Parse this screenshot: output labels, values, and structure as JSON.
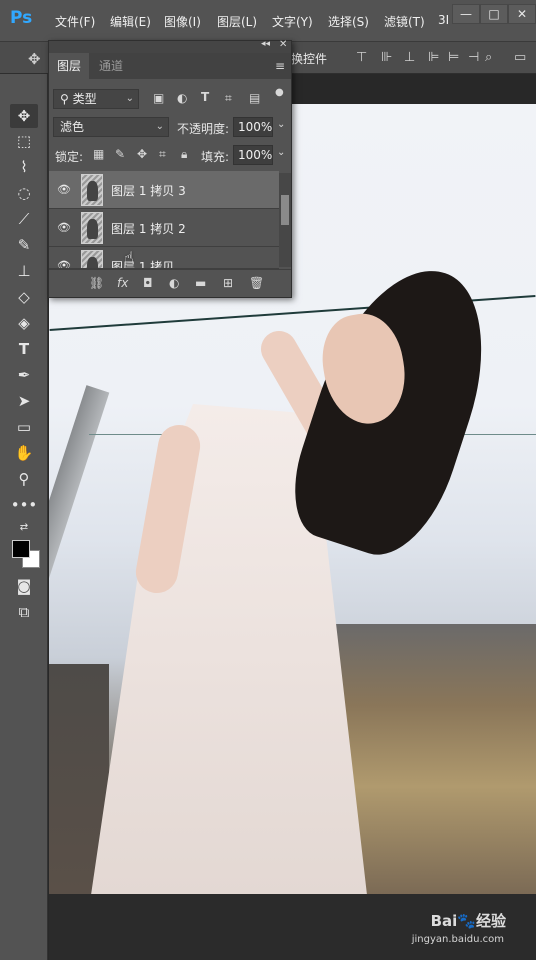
{
  "app": {
    "logo": "Ps"
  },
  "menu": [
    "文件(F)",
    "编辑(E)",
    "图像(I)",
    "图层(L)",
    "文字(Y)",
    "选择(S)",
    "滤镜(T)",
    "3I"
  ],
  "window_controls": {
    "minimize": "—",
    "maximize": "□",
    "close": "✕"
  },
  "options_bar": {
    "transform_label": "换控件"
  },
  "layers_panel": {
    "tabs": [
      "图层",
      "通道"
    ],
    "filter": {
      "label": "类型"
    },
    "blend_mode": "滤色",
    "opacity_label": "不透明度:",
    "opacity_value": "100%",
    "lock_label": "锁定:",
    "fill_label": "填充:",
    "fill_value": "100%",
    "layers": [
      {
        "name": "图层 1 拷贝 3",
        "selected": true
      },
      {
        "name": "图层 1 拷贝 2",
        "selected": false
      },
      {
        "name": "图层 1 拷贝",
        "selected": false
      }
    ],
    "footer_icons": [
      "link-icon",
      "fx-icon",
      "mask-icon",
      "adjustment-icon",
      "folder-icon",
      "new-layer-icon",
      "trash-icon"
    ]
  },
  "tools": [
    "move-tool",
    "marquee-tool",
    "lasso-tool",
    "quick-select-tool",
    "eyedropper-tool",
    "brush-tool",
    "stamp-tool",
    "eraser-tool",
    "dodge-tool",
    "type-tool",
    "pen-tool",
    "path-select-tool",
    "rectangle-tool",
    "hand-tool",
    "zoom-tool",
    "more-tools"
  ],
  "watermark": {
    "brand": "Bai🐾经验",
    "url": "jingyan.baidu.com"
  },
  "colors": {
    "accent": "#31a8ff",
    "panel": "#535353",
    "selected_layer": "#6a6a6a"
  }
}
